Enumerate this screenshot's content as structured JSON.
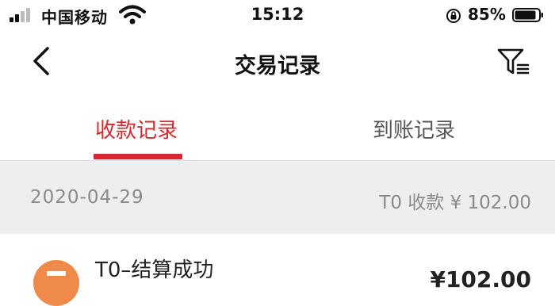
{
  "status_bar": {
    "carrier": "中国移动",
    "time": "15:12",
    "battery": "85%",
    "icons": [
      "signal-icon",
      "wifi-icon",
      "rotation-lock-icon",
      "battery-icon"
    ]
  },
  "nav": {
    "title": "交易记录",
    "icons": [
      "back-icon",
      "filter-icon"
    ]
  },
  "tabs": [
    {
      "label": "收款记录",
      "active": true
    },
    {
      "label": "到账记录",
      "active": false
    }
  ],
  "date_group": {
    "date": "2020-04-29",
    "summary": "T0 收款 ¥ 102.00"
  },
  "records": [
    {
      "title": "T0–结算成功",
      "amount": "¥102.00",
      "icon": "receipt-icon"
    }
  ],
  "colors": {
    "accent": "#d6282e",
    "icon_orange": "#f08a4b",
    "header_bg": "#eeeeee",
    "muted_text": "#8a8a8a"
  }
}
